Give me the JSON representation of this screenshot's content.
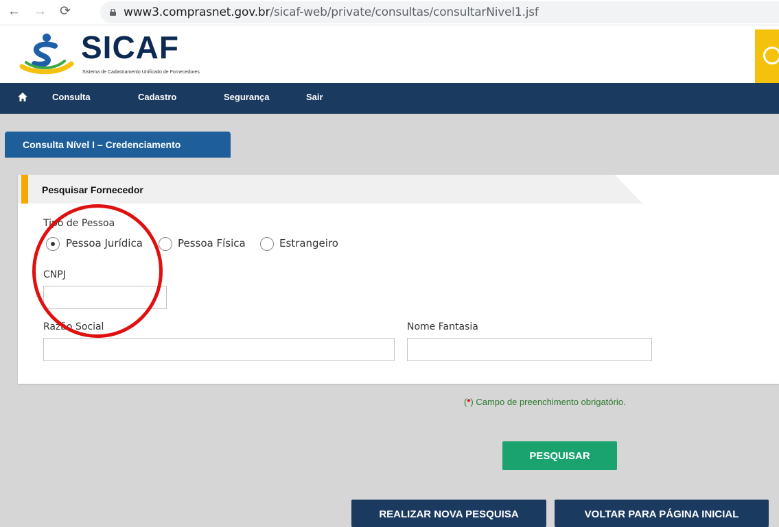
{
  "browser": {
    "url_domain": "www3.comprasnet.gov.br",
    "url_path": "/sicaf-web/private/consultas/consultarNivel1.jsf"
  },
  "header": {
    "logo_title": "SICAF",
    "logo_subtitle": "Sistema de Cadastramento Unificado de Fornecedores"
  },
  "menu": {
    "items": [
      {
        "label": "Consulta"
      },
      {
        "label": "Cadastro"
      },
      {
        "label": "Segurança"
      },
      {
        "label": "Sair"
      }
    ]
  },
  "tab": {
    "label": "Consulta Nível I – Credenciamento"
  },
  "form": {
    "title": "Pesquisar Fornecedor",
    "tipo_pessoa_label": "Tipo de Pessoa",
    "radio_options": [
      {
        "label": "Pessoa Jurídica",
        "checked": true
      },
      {
        "label": "Pessoa Física",
        "checked": false
      },
      {
        "label": "Estrangeiro",
        "checked": false
      }
    ],
    "cnpj_label": "CNPJ",
    "cnpj_value": "",
    "razao_social_label": "Razão Social",
    "razao_social_value": "",
    "nome_fantasia_label": "Nome Fantasia",
    "nome_fantasia_value": ""
  },
  "required_note": {
    "open": "(",
    "star": "*",
    "text": ") Campo de preenchimento obrigatório."
  },
  "buttons": {
    "search": "PESQUISAR",
    "new_search": "REALIZAR NOVA PESQUISA",
    "back_home": "VOLTAR PARA PÁGINA INICIAL"
  },
  "colors": {
    "navy": "#1b3a5f",
    "tab_blue": "#1e5f9a",
    "accent_orange": "#f5a800",
    "green_button": "#1aa36f",
    "annotation_red": "#e01010"
  }
}
